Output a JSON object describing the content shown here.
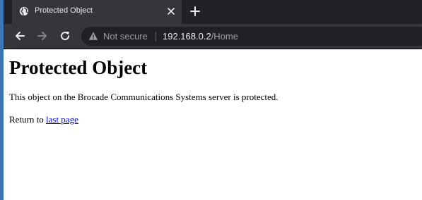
{
  "tab": {
    "title": "Protected Object",
    "favicon": "globe-icon"
  },
  "toolbar": {
    "back_icon": "back-arrow-icon",
    "forward_icon": "forward-arrow-icon",
    "reload_icon": "reload-icon"
  },
  "omnibox": {
    "security_label": "Not secure",
    "url_host": "192.168.0.2",
    "url_path": "/Home"
  },
  "page": {
    "heading": "Protected Object",
    "message": "This object on the Brocade Communications Systems server is protected.",
    "return_prefix": "Return to ",
    "return_link": "last page"
  },
  "colors": {
    "tabstrip": "#202124",
    "toolbar": "#35363a",
    "link": "#0000ee"
  }
}
